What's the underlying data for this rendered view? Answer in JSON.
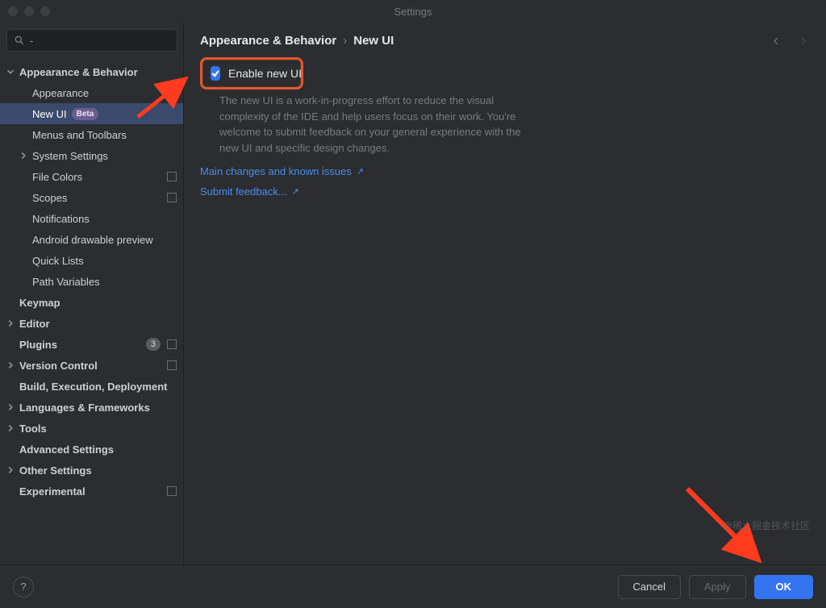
{
  "window": {
    "title": "Settings"
  },
  "search": {
    "placeholder": ""
  },
  "breadcrumb": {
    "parent": "Appearance & Behavior",
    "current": "New UI"
  },
  "checkbox": {
    "label": "Enable new UI",
    "checked": true
  },
  "description": "The new UI is a work-in-progress effort to reduce the visual complexity of the IDE and help users focus on their work. You're welcome to submit feedback on your general experience with the new UI and specific design changes.",
  "links": {
    "changes": "Main changes and known issues",
    "feedback": "Submit feedback..."
  },
  "footer": {
    "cancel": "Cancel",
    "apply": "Apply",
    "ok": "OK"
  },
  "watermark": "@稀土掘金技术社区",
  "sidebar": [
    {
      "label": "Appearance & Behavior",
      "indent": 0,
      "bold": true,
      "children": true,
      "expanded": true
    },
    {
      "label": "Appearance",
      "indent": 1
    },
    {
      "label": "New UI",
      "indent": 1,
      "selected": true,
      "beta": "Beta"
    },
    {
      "label": "Menus and Toolbars",
      "indent": 1
    },
    {
      "label": "System Settings",
      "indent": 1,
      "children": true
    },
    {
      "label": "File Colors",
      "indent": 1,
      "control": true
    },
    {
      "label": "Scopes",
      "indent": 1,
      "control": true
    },
    {
      "label": "Notifications",
      "indent": 1
    },
    {
      "label": "Android drawable preview",
      "indent": 1
    },
    {
      "label": "Quick Lists",
      "indent": 1
    },
    {
      "label": "Path Variables",
      "indent": 1
    },
    {
      "label": "Keymap",
      "indent": 0,
      "bold": true
    },
    {
      "label": "Editor",
      "indent": 0,
      "bold": true,
      "children": true
    },
    {
      "label": "Plugins",
      "indent": 0,
      "bold": true,
      "count": "3",
      "control": true
    },
    {
      "label": "Version Control",
      "indent": 0,
      "bold": true,
      "children": true,
      "control": true
    },
    {
      "label": "Build, Execution, Deployment",
      "indent": 0,
      "bold": true
    },
    {
      "label": "Languages & Frameworks",
      "indent": 0,
      "bold": true,
      "children": true
    },
    {
      "label": "Tools",
      "indent": 0,
      "bold": true,
      "children": true
    },
    {
      "label": "Advanced Settings",
      "indent": 0,
      "bold": true
    },
    {
      "label": "Other Settings",
      "indent": 0,
      "bold": true,
      "children": true
    },
    {
      "label": "Experimental",
      "indent": 0,
      "bold": true,
      "control": true
    }
  ]
}
